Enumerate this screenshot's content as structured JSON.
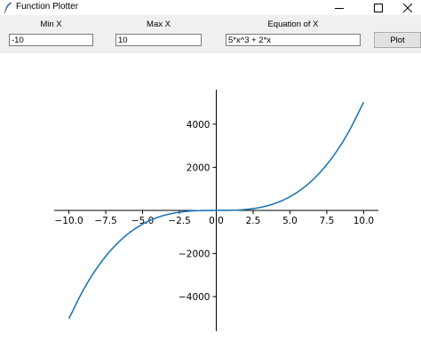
{
  "window": {
    "title": "Function Plotter",
    "icon": "feather-icon"
  },
  "controls": {
    "min_x_label": "Min X",
    "min_x_value": "-10",
    "max_x_label": "Max X",
    "max_x_value": "10",
    "equation_label": "Equation of X",
    "equation_value": "5*x^3 + 2*x",
    "plot_button": "Plot"
  },
  "chart_data": {
    "type": "line",
    "title": "",
    "xlabel": "",
    "ylabel": "",
    "xlim": [
      -11,
      11
    ],
    "ylim": [
      -5600,
      5600
    ],
    "x_ticks": [
      -10,
      -7.5,
      -5,
      -2.5,
      0,
      2.5,
      5,
      7.5,
      10
    ],
    "x_tick_labels": [
      "−10.0",
      "−7.5",
      "−5.0",
      "−2.5",
      "0.0",
      "2.5",
      "5.0",
      "7.5",
      "10.0"
    ],
    "y_ticks": [
      -4000,
      -2000,
      2000,
      4000
    ],
    "y_tick_labels": [
      "−4000",
      "−2000",
      "2000",
      "4000"
    ],
    "grid": false,
    "spines": "centered",
    "series": [
      {
        "color": "#1f77b4",
        "x": [
          -10,
          -9,
          -8,
          -7,
          -6,
          -5,
          -4,
          -3,
          -2,
          -1,
          0,
          1,
          2,
          3,
          4,
          5,
          6,
          7,
          8,
          9,
          10
        ],
        "y": [
          -5020,
          -3663,
          -2576,
          -1729,
          -1092,
          -635,
          -328,
          -141,
          -44,
          -7,
          0,
          7,
          44,
          141,
          328,
          635,
          1092,
          1729,
          2576,
          3663,
          5020
        ]
      }
    ]
  }
}
